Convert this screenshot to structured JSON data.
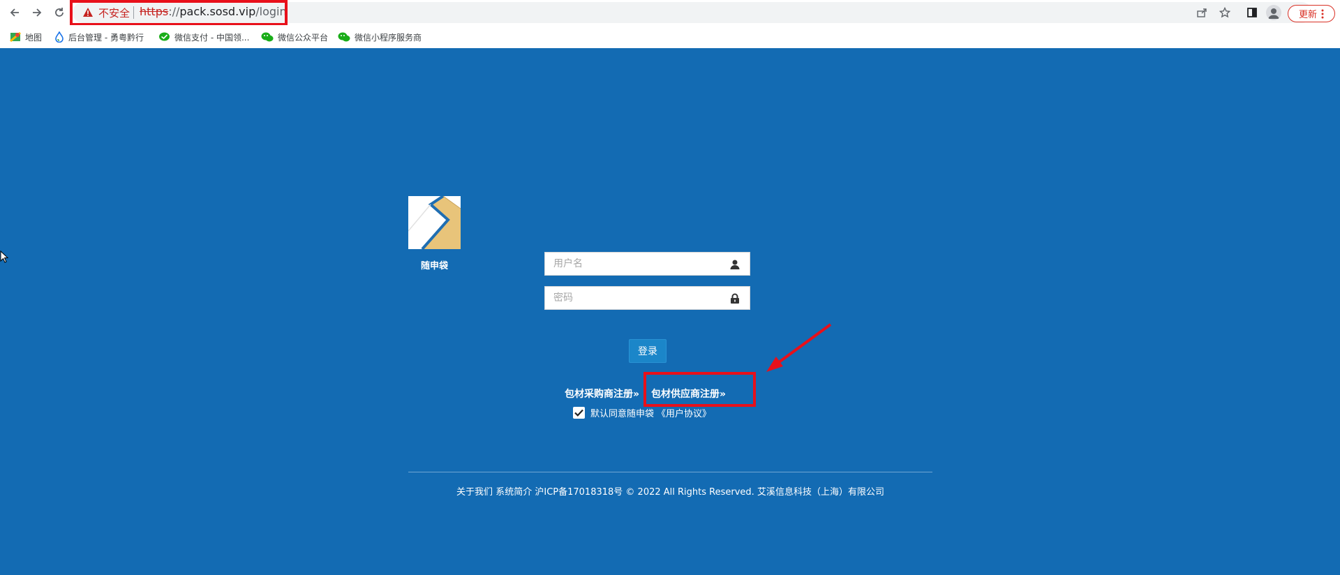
{
  "browser": {
    "security_label": "不安全",
    "url_scheme": "https",
    "url_rest": "://",
    "url_host": "pack.sosd.vip",
    "url_path": "/login",
    "update_label": "更新"
  },
  "bookmarks": [
    {
      "label": "地图",
      "icon": "maps-icon"
    },
    {
      "label": "后台管理 - 勇粤黔行",
      "icon": "drop-icon"
    },
    {
      "label": "微信支付 - 中国领...",
      "icon": "wechat-pay-icon"
    },
    {
      "label": "微信公众平台",
      "icon": "wechat-icon"
    },
    {
      "label": "微信小程序服务商",
      "icon": "wechat-icon"
    }
  ],
  "brand": {
    "name": "随申袋"
  },
  "form": {
    "username_placeholder": "用户名",
    "password_placeholder": "密码",
    "login_label": "登录",
    "buyer_register": "包材采购商注册»",
    "supplier_register": "包材供应商注册»",
    "agree_text": "默认同意随申袋",
    "agreement_link": "《用户协议》",
    "agree_checked": true
  },
  "footer": {
    "about": "关于我们",
    "intro": "系统简介",
    "icp": "沪ICP备17018318号",
    "copyright": "© 2022 All Rights Reserved.",
    "company": "艾溪信息科技（上海）有限公司"
  },
  "colors": {
    "page_bg": "#136bb3",
    "annotation": "#e8101a",
    "login_button": "#1b86c9"
  }
}
